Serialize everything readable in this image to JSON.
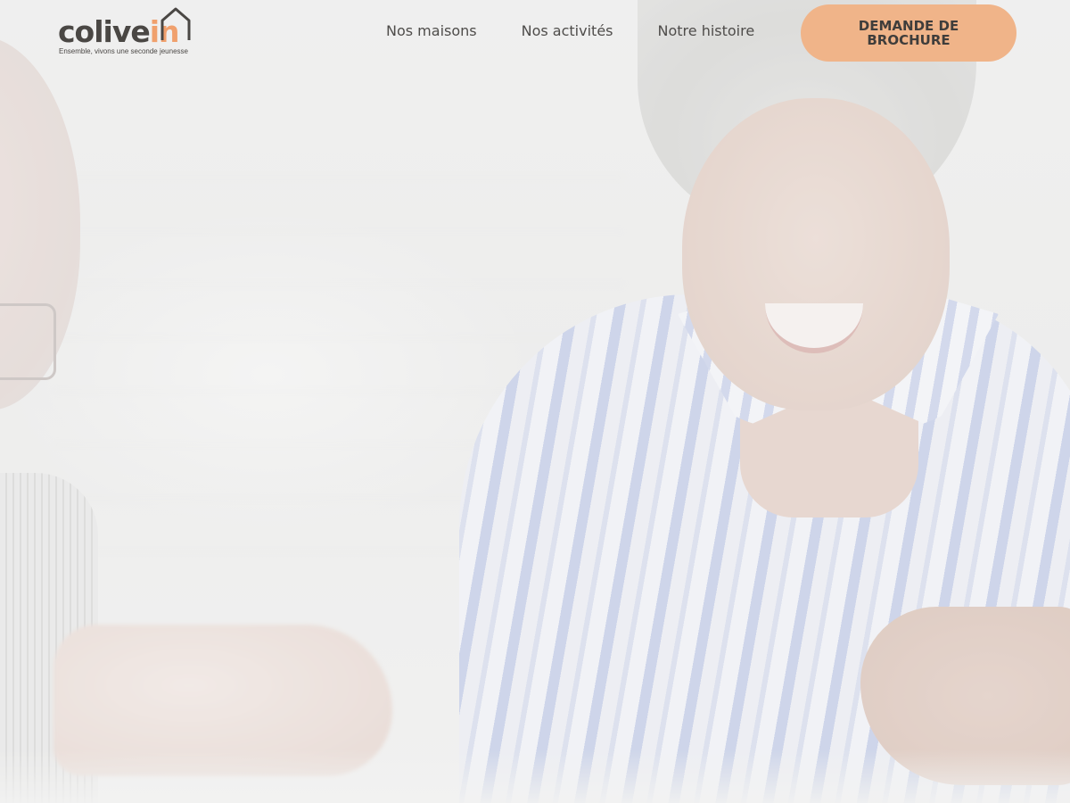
{
  "brand": {
    "name_main": "colive",
    "name_accent": "in",
    "tagline": "Ensemble, vivons une seconde jeunesse",
    "accent_color": "#f0a06d",
    "text_color": "#4a4744",
    "logo_icon": "house-outline-icon"
  },
  "nav": {
    "items": [
      {
        "label": "Nos maisons"
      },
      {
        "label": "Nos activités"
      },
      {
        "label": "Notre histoire"
      }
    ]
  },
  "cta": {
    "label": "DEMANDE DE BROCHURE",
    "background": "#f0b489"
  },
  "hero": {
    "image": "photo of two smiling senior people playing a board game at a table"
  }
}
